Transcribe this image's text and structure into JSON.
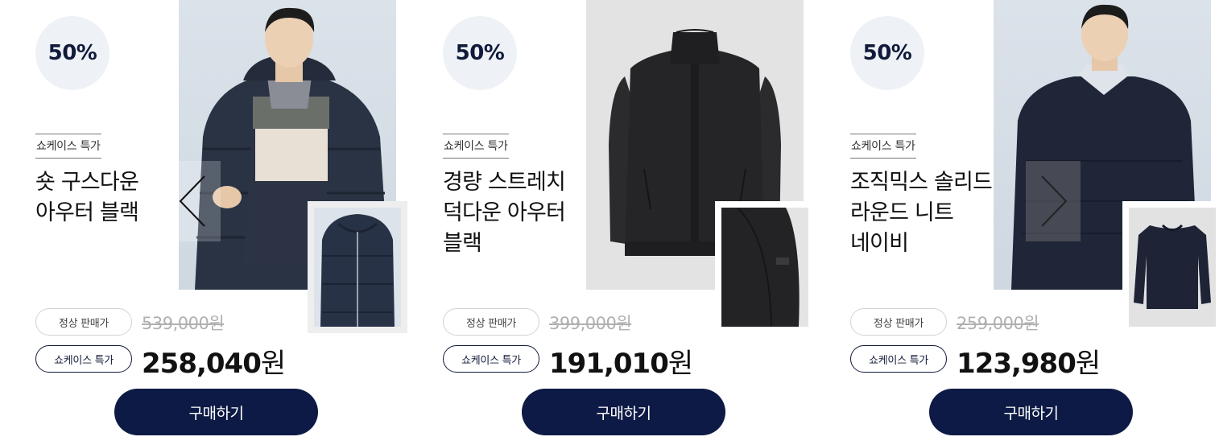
{
  "carousel": {
    "prev_label": "이전",
    "next_label": "다음"
  },
  "products": [
    {
      "discount": "50%",
      "tag": "쇼케이스 특가",
      "title_lines": [
        "숏 구스다운",
        "아우터 블랙"
      ],
      "normal_label": "정상 판매가",
      "original_price": "539,000원",
      "special_label": "쇼케이스 특가",
      "sale_price_number": "258,040",
      "sale_price_unit": "원",
      "buy_label": "구매하기",
      "photo_icon": "puffer-jacket-model-photo",
      "thumb_icon": "puffer-jacket-detail-thumbnail"
    },
    {
      "discount": "50%",
      "tag": "쇼케이스 특가",
      "title_lines": [
        "경량 스트레치",
        "덕다운 아우터",
        "블랙"
      ],
      "normal_label": "정상 판매가",
      "original_price": "399,000원",
      "special_label": "쇼케이스 특가",
      "sale_price_number": "191,010",
      "sale_price_unit": "원",
      "buy_label": "구매하기",
      "photo_icon": "down-jacket-product-photo",
      "thumb_icon": "down-jacket-sleeve-thumbnail"
    },
    {
      "discount": "50%",
      "tag": "쇼케이스 특가",
      "title_lines": [
        "조직믹스 솔리드",
        "라운드 니트",
        "네이비"
      ],
      "normal_label": "정상 판매가",
      "original_price": "259,000원",
      "special_label": "쇼케이스 특가",
      "sale_price_number": "123,980",
      "sale_price_unit": "원",
      "buy_label": "구매하기",
      "photo_icon": "knit-sweater-model-photo",
      "thumb_icon": "knit-sweater-thumbnail"
    }
  ],
  "colors": {
    "navy": "#0c1a45",
    "badge_bg": "#eef2f6",
    "strike_grey": "#b0b0b0"
  }
}
